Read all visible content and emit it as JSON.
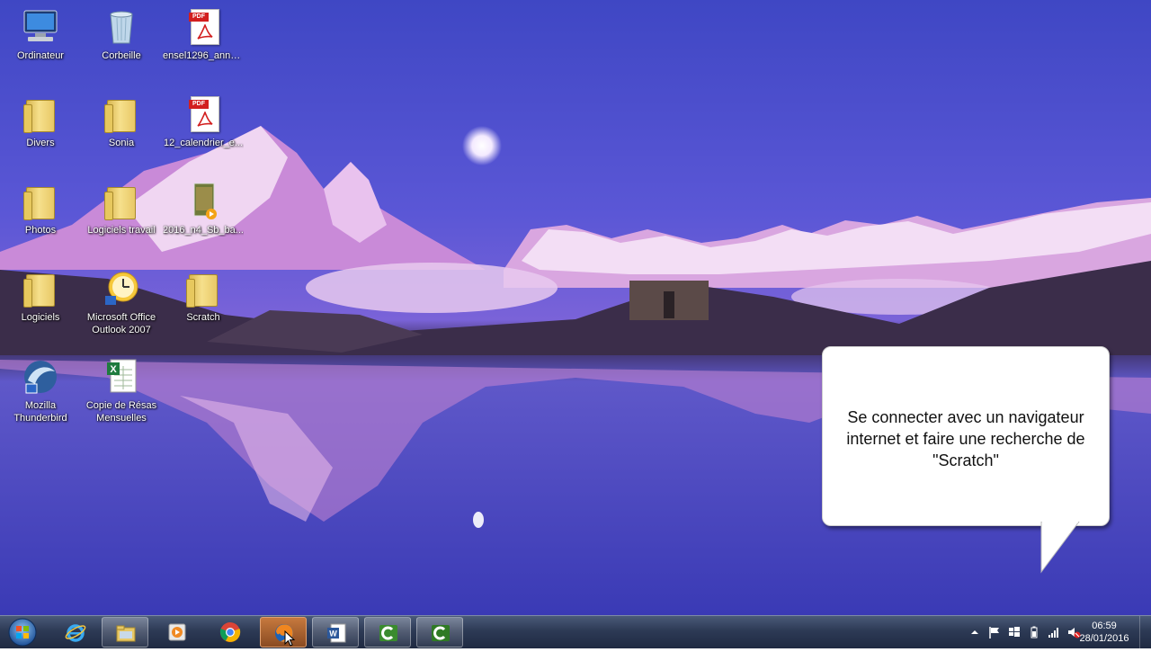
{
  "desktop": {
    "icons": [
      {
        "label": "Ordinateur"
      },
      {
        "label": "Corbeille"
      },
      {
        "label": "ensel1296_anne..."
      },
      {
        "label": "Divers"
      },
      {
        "label": "Sonia"
      },
      {
        "label": "12_calendrier_e..."
      },
      {
        "label": "Photos"
      },
      {
        "label": "Logiciels travail"
      },
      {
        "label": "2016_n4_Sb_ba..."
      },
      {
        "label": "Logiciels"
      },
      {
        "label": "Microsoft Office Outlook 2007"
      },
      {
        "label": "Scratch"
      },
      {
        "label": "Mozilla Thunderbird"
      },
      {
        "label": "Copie de Résas Mensuelles"
      }
    ],
    "pdf_tag": "PDF"
  },
  "callout": {
    "text": "Se connecter avec un navigateur internet et faire une recherche de \"Scratch\""
  },
  "taskbar": {
    "pinned": [
      {
        "icon": "internet-explorer-icon"
      },
      {
        "icon": "file-explorer-icon"
      },
      {
        "icon": "media-player-icon"
      },
      {
        "icon": "chrome-icon"
      },
      {
        "icon": "firefox-icon"
      },
      {
        "icon": "word-icon"
      },
      {
        "icon": "camtasia-icon"
      },
      {
        "icon": "camtasia-recorder-icon"
      }
    ],
    "clock": {
      "time": "06:59",
      "date": "28/01/2016"
    }
  },
  "colors": {
    "accent": "#2b66c6",
    "taskbar": "#2d3a55"
  }
}
